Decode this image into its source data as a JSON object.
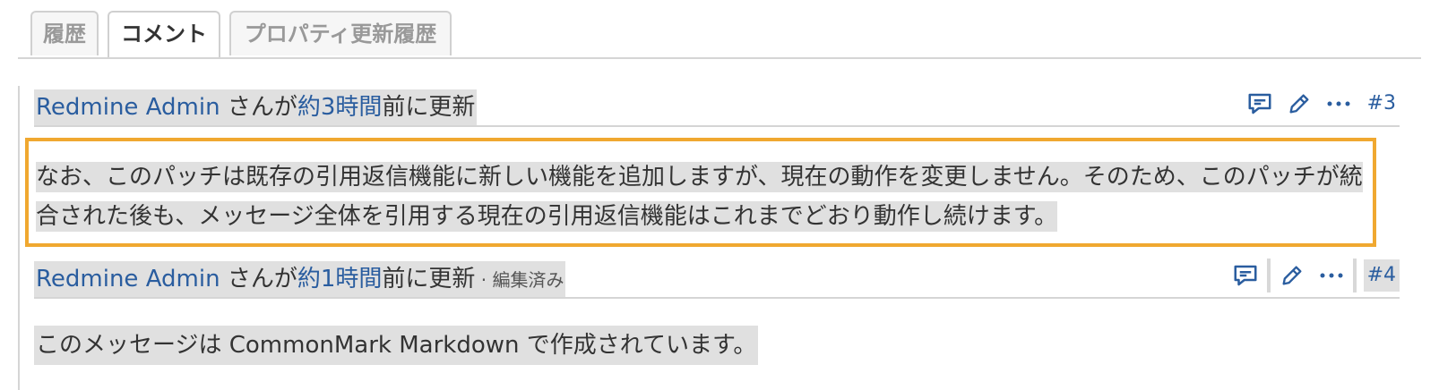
{
  "tabs": [
    {
      "label": "履歴",
      "active": false
    },
    {
      "label": "コメント",
      "active": true
    },
    {
      "label": "プロパティ更新履歴",
      "active": false
    }
  ],
  "journals": [
    {
      "author": "Redmine Admin",
      "san_ga": " さんが",
      "time_link": "約3時間",
      "updated": "前に更新",
      "edited": "",
      "number": "#3",
      "body": "なお、このパッチは既存の引用返信機能に新しい機能を追加しますが、現在の動作を変更しません。そのため、このパッチが統合された後も、メッセージ全体を引用する現在の引用返信機能はこれまでどおり動作し続けます。"
    },
    {
      "author": "Redmine Admin",
      "san_ga": " さんが",
      "time_link": "約1時間",
      "updated": "前に更新",
      "edited": " · 編集済み",
      "number": "#4",
      "body": "このメッセージは CommonMark Markdown で作成されています。"
    }
  ],
  "icons": {
    "quote": "speech-bubble-icon",
    "edit": "pencil-icon",
    "more": "ellipsis-icon"
  },
  "colors": {
    "link": "#2a5d9f",
    "highlight": "#f0a830",
    "selection": "#e0e0e0"
  }
}
